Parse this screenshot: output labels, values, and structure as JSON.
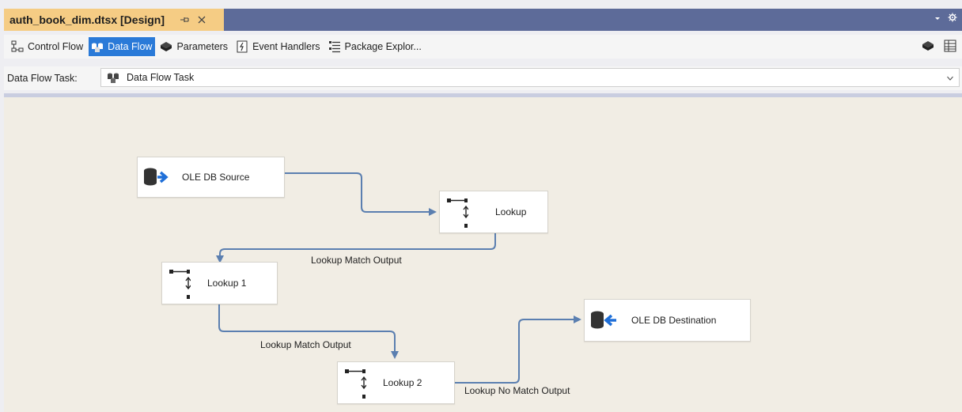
{
  "document_tab": {
    "title": "auth_book_dim.dtsx [Design]"
  },
  "designer_tabs": [
    {
      "label": "Control Flow",
      "icon": "control-flow-icon",
      "active": false
    },
    {
      "label": "Data Flow",
      "icon": "data-flow-icon",
      "active": true
    },
    {
      "label": "Parameters",
      "icon": "parameters-icon",
      "active": false
    },
    {
      "label": "Event Handlers",
      "icon": "event-handlers-icon",
      "active": false
    },
    {
      "label": "Package Explor...",
      "icon": "package-explorer-icon",
      "active": false
    }
  ],
  "task_selector": {
    "label": "Data Flow Task:",
    "value": "Data Flow Task"
  },
  "components": {
    "ole_db_source": {
      "label": "OLE DB Source",
      "icon": "ole-db-source-icon"
    },
    "lookup": {
      "label": "Lookup",
      "icon": "lookup-icon"
    },
    "lookup_1": {
      "label": "Lookup 1",
      "icon": "lookup-icon"
    },
    "lookup_2": {
      "label": "Lookup 2",
      "icon": "lookup-icon"
    },
    "ole_db_destination": {
      "label": "OLE DB Destination",
      "icon": "ole-db-destination-icon"
    }
  },
  "paths": {
    "lookup_to_lookup1": "Lookup Match Output",
    "lookup1_to_lookup2": "Lookup Match Output",
    "lookup2_to_destination": "Lookup No Match Output"
  },
  "colors": {
    "tab_strip": "#5d6b99",
    "active_doc_tab": "#f5cc84",
    "active_designer_tab": "#2a7ad8",
    "canvas": "#f1ede4",
    "connector": "#5b7fb0"
  }
}
